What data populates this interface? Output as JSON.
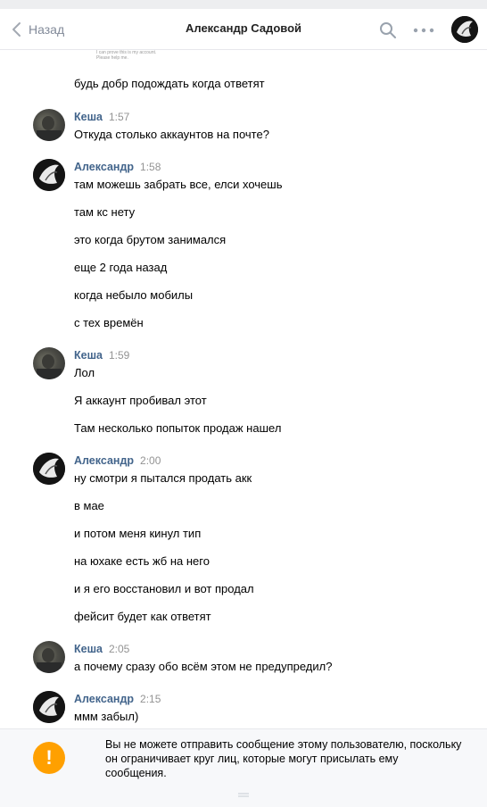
{
  "header": {
    "back_label": "Назад",
    "title": "Александр Садовой"
  },
  "history": {
    "quote_fragment_1": "I can prove this is my account.",
    "quote_fragment_2": "Please help me.",
    "top_line": "будь добр подождать когда ответят",
    "groups": [
      {
        "author": "Кеша",
        "time": "1:57",
        "messages": [
          "Откуда столько аккаунтов на почте?"
        ]
      },
      {
        "author": "Александр",
        "time": "1:58",
        "messages": [
          "там можешь забрать все, елси хочешь",
          "там кс нету",
          "это когда брутом занимался",
          "еще 2 года назад",
          "когда небыло мобилы",
          "с тех времён"
        ]
      },
      {
        "author": "Кеша",
        "time": "1:59",
        "messages": [
          "Лол",
          "Я аккаунт пробивал этот",
          "Там несколько попыток продаж нашел"
        ]
      },
      {
        "author": "Александр",
        "time": "2:00",
        "messages": [
          "ну смотри я пытался продать акк",
          "в мае",
          "и потом меня кинул тип",
          "на юхаке есть жб на него",
          "и я его восстановил и вот продал",
          "фейсит будет как ответят"
        ]
      },
      {
        "author": "Кеша",
        "time": "2:05",
        "messages": [
          "а почему сразу обо всём этом не предупредил?"
        ]
      },
      {
        "author": "Александр",
        "time": "2:15",
        "messages": [
          "ммм забыл)"
        ]
      }
    ]
  },
  "notice": {
    "icon_char": "!",
    "text": "Вы не можете отправить сообщение этому пользователю, поскольку он ограничивает круг лиц, которые могут присылать ему сообщения."
  },
  "colors": {
    "author": "#42648b",
    "time": "#939393",
    "warning": "#ffa000",
    "background": "#edeef0"
  }
}
